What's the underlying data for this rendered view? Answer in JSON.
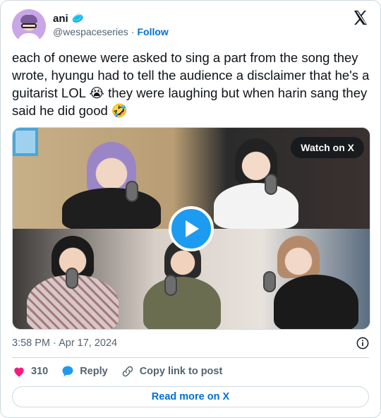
{
  "user": {
    "name": "ani",
    "badge_emoji": "🥏",
    "handle": "@wespaceseries",
    "separator": "·",
    "follow_label": "Follow"
  },
  "tweet": {
    "text": "each of onewe were asked to sing a part from the song they wrote, hyungu had to tell the audience a disclaimer that he's a guitarist LOL 😭 they were laughing but when harin sang they said he did good 🤣"
  },
  "media": {
    "watch_label": "Watch on X"
  },
  "meta": {
    "timestamp": "3:58 PM · Apr 17, 2024"
  },
  "actions": {
    "like_count": "310",
    "reply_label": "Reply",
    "copy_label": "Copy link to post"
  },
  "footer": {
    "read_more_label": "Read more on X"
  },
  "colors": {
    "accent": "#1d9bf0",
    "link": "#006fd6",
    "like": "#f91880",
    "muted": "#536471"
  }
}
